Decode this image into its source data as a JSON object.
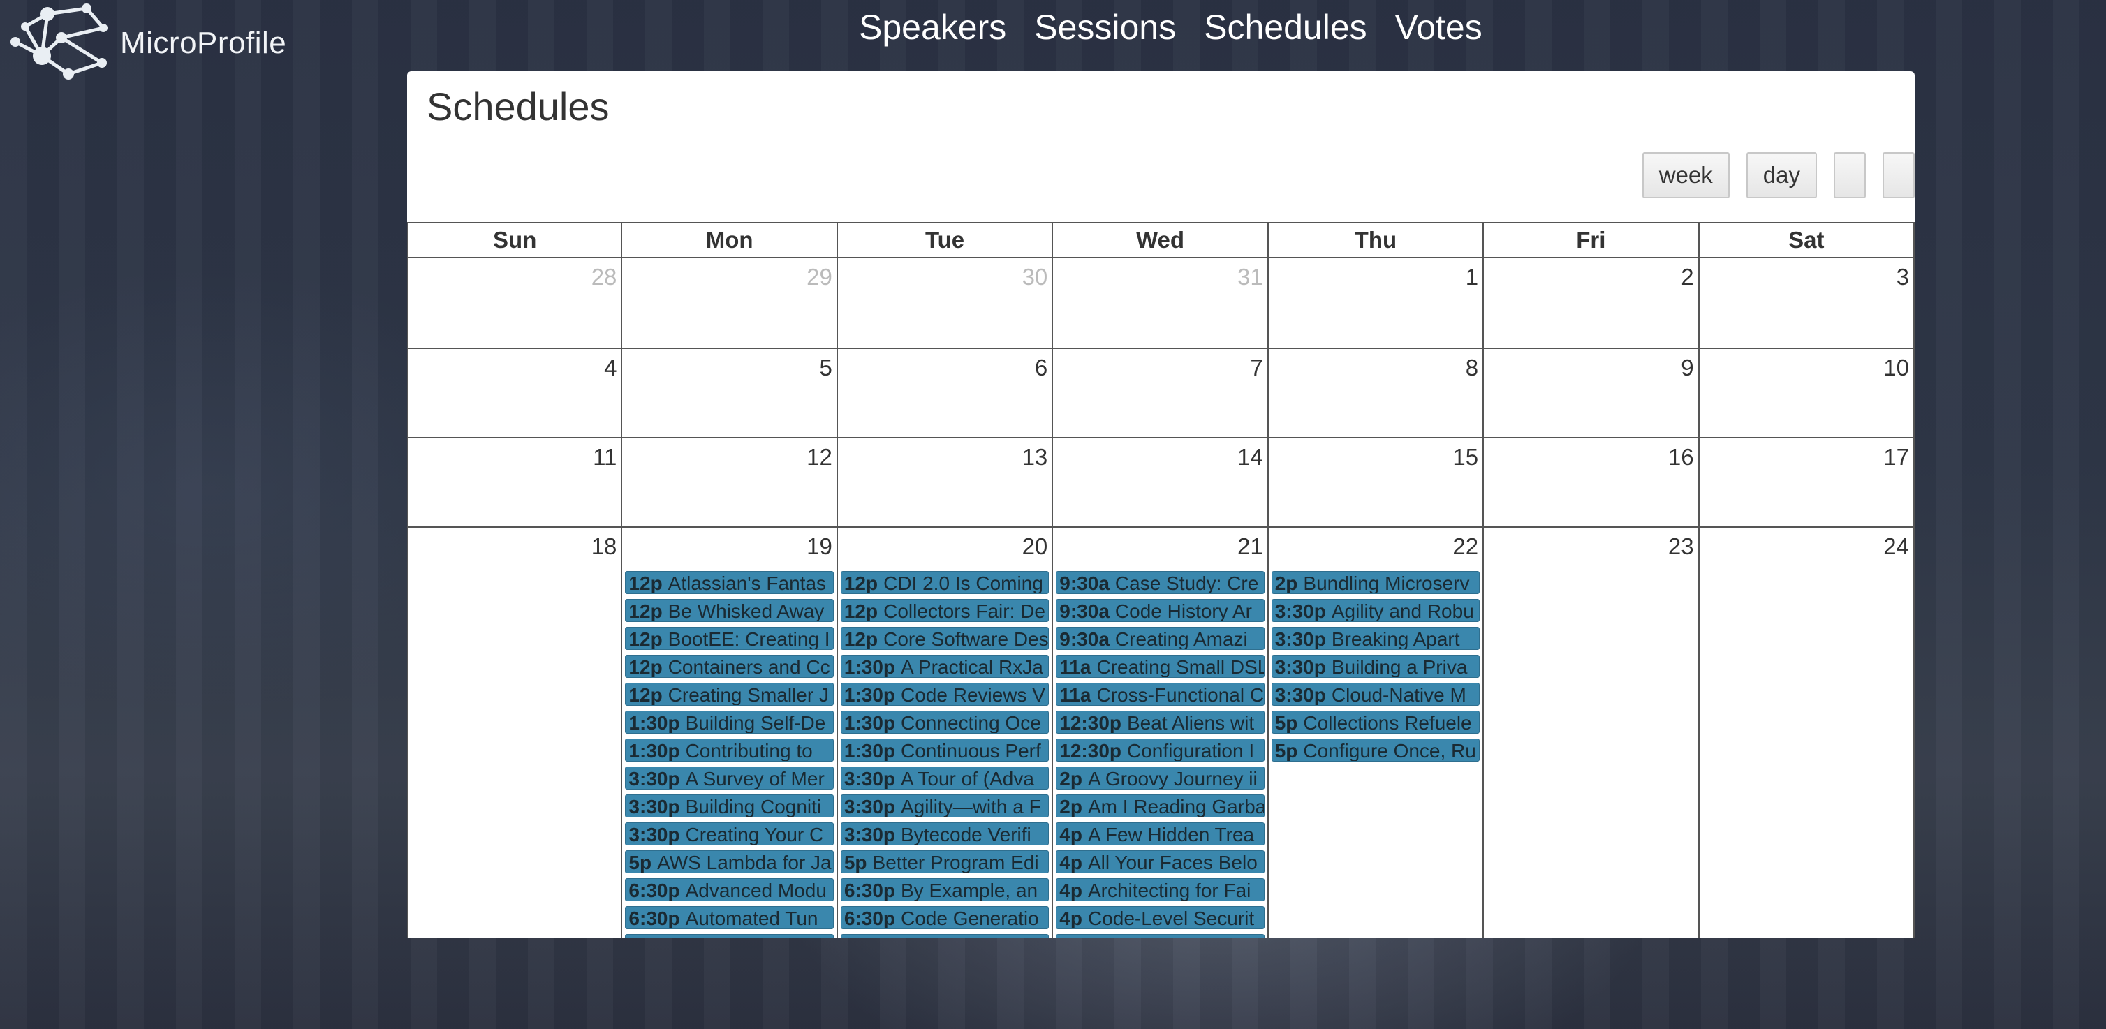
{
  "app": {
    "title": "MicroProfile"
  },
  "nav": [
    "Speakers",
    "Sessions",
    "Schedules",
    "Votes"
  ],
  "page": {
    "title": "Schedules"
  },
  "toolbar": {
    "buttons": [
      "week",
      "day",
      "",
      ""
    ]
  },
  "colors": {
    "event": "#3a87ad",
    "panel": "#ffffff"
  },
  "calendar": {
    "weekdays": [
      "Sun",
      "Mon",
      "Tue",
      "Wed",
      "Thu",
      "Fri",
      "Sat"
    ],
    "weeks": [
      [
        {
          "d": "28",
          "other": true
        },
        {
          "d": "29",
          "other": true
        },
        {
          "d": "30",
          "other": true
        },
        {
          "d": "31",
          "other": true
        },
        {
          "d": "1"
        },
        {
          "d": "2"
        },
        {
          "d": "3"
        }
      ],
      [
        {
          "d": "4"
        },
        {
          "d": "5"
        },
        {
          "d": "6"
        },
        {
          "d": "7"
        },
        {
          "d": "8"
        },
        {
          "d": "9"
        },
        {
          "d": "10"
        }
      ],
      [
        {
          "d": "11"
        },
        {
          "d": "12"
        },
        {
          "d": "13"
        },
        {
          "d": "14"
        },
        {
          "d": "15"
        },
        {
          "d": "16"
        },
        {
          "d": "17"
        }
      ],
      [
        {
          "d": "18"
        },
        {
          "d": "19",
          "events": [
            {
              "time": "12p",
              "title": "Atlassian's Fantas"
            },
            {
              "time": "12p",
              "title": "Be Whisked Away"
            },
            {
              "time": "12p",
              "title": "BootEE: Creating I"
            },
            {
              "time": "12p",
              "title": "Containers and Cc"
            },
            {
              "time": "12p",
              "title": "Creating Smaller J"
            },
            {
              "time": "1:30p",
              "title": "Building Self-De"
            },
            {
              "time": "1:30p",
              "title": "Contributing to"
            },
            {
              "time": "3:30p",
              "title": "A Survey of Mer"
            },
            {
              "time": "3:30p",
              "title": "Building Cogniti"
            },
            {
              "time": "3:30p",
              "title": "Creating Your C"
            },
            {
              "time": "5p",
              "title": "AWS Lambda for Ja"
            },
            {
              "time": "6:30p",
              "title": "Advanced Modu"
            },
            {
              "time": "6:30p",
              "title": "Automated Tun"
            },
            {
              "time": "",
              "title": ""
            }
          ]
        },
        {
          "d": "20",
          "events": [
            {
              "time": "12p",
              "title": "CDI 2.0 Is Coming"
            },
            {
              "time": "12p",
              "title": "Collectors Fair: De"
            },
            {
              "time": "12p",
              "title": "Core Software Des"
            },
            {
              "time": "1:30p",
              "title": "A Practical RxJa"
            },
            {
              "time": "1:30p",
              "title": "Code Reviews V"
            },
            {
              "time": "1:30p",
              "title": "Connecting Oce"
            },
            {
              "time": "1:30p",
              "title": "Continuous Perf"
            },
            {
              "time": "3:30p",
              "title": "A Tour of (Adva"
            },
            {
              "time": "3:30p",
              "title": "Agility—with a F"
            },
            {
              "time": "3:30p",
              "title": "Bytecode Verifi"
            },
            {
              "time": "5p",
              "title": "Better Program Edi"
            },
            {
              "time": "6:30p",
              "title": "By Example, an"
            },
            {
              "time": "6:30p",
              "title": "Code Generatio"
            },
            {
              "time": "",
              "title": ""
            }
          ]
        },
        {
          "d": "21",
          "events": [
            {
              "time": "9:30a",
              "title": "Case Study: Cre"
            },
            {
              "time": "9:30a",
              "title": "Code History Ar"
            },
            {
              "time": "9:30a",
              "title": "Creating Amazi"
            },
            {
              "time": "11a",
              "title": "Creating Small DSL"
            },
            {
              "time": "11a",
              "title": "Cross-Functional C"
            },
            {
              "time": "12:30p",
              "title": "Beat Aliens wit"
            },
            {
              "time": "12:30p",
              "title": "Configuration I"
            },
            {
              "time": "2p",
              "title": "A Groovy Journey ii"
            },
            {
              "time": "2p",
              "title": "Am I Reading Garba"
            },
            {
              "time": "4p",
              "title": "A Few Hidden Trea"
            },
            {
              "time": "4p",
              "title": "All Your Faces Belo"
            },
            {
              "time": "4p",
              "title": "Architecting for Fai"
            },
            {
              "time": "4p",
              "title": "Code-Level Securit"
            },
            {
              "time": "",
              "title": ""
            }
          ]
        },
        {
          "d": "22",
          "events": [
            {
              "time": "2p",
              "title": "Bundling Microserv"
            },
            {
              "time": "3:30p",
              "title": "Agility and Robu"
            },
            {
              "time": "3:30p",
              "title": "Breaking Apart"
            },
            {
              "time": "3:30p",
              "title": "Building a Priva"
            },
            {
              "time": "3:30p",
              "title": "Cloud-Native M"
            },
            {
              "time": "5p",
              "title": "Collections Refuele"
            },
            {
              "time": "5p",
              "title": "Configure Once, Ru"
            }
          ]
        },
        {
          "d": "23"
        },
        {
          "d": "24"
        }
      ]
    ]
  }
}
